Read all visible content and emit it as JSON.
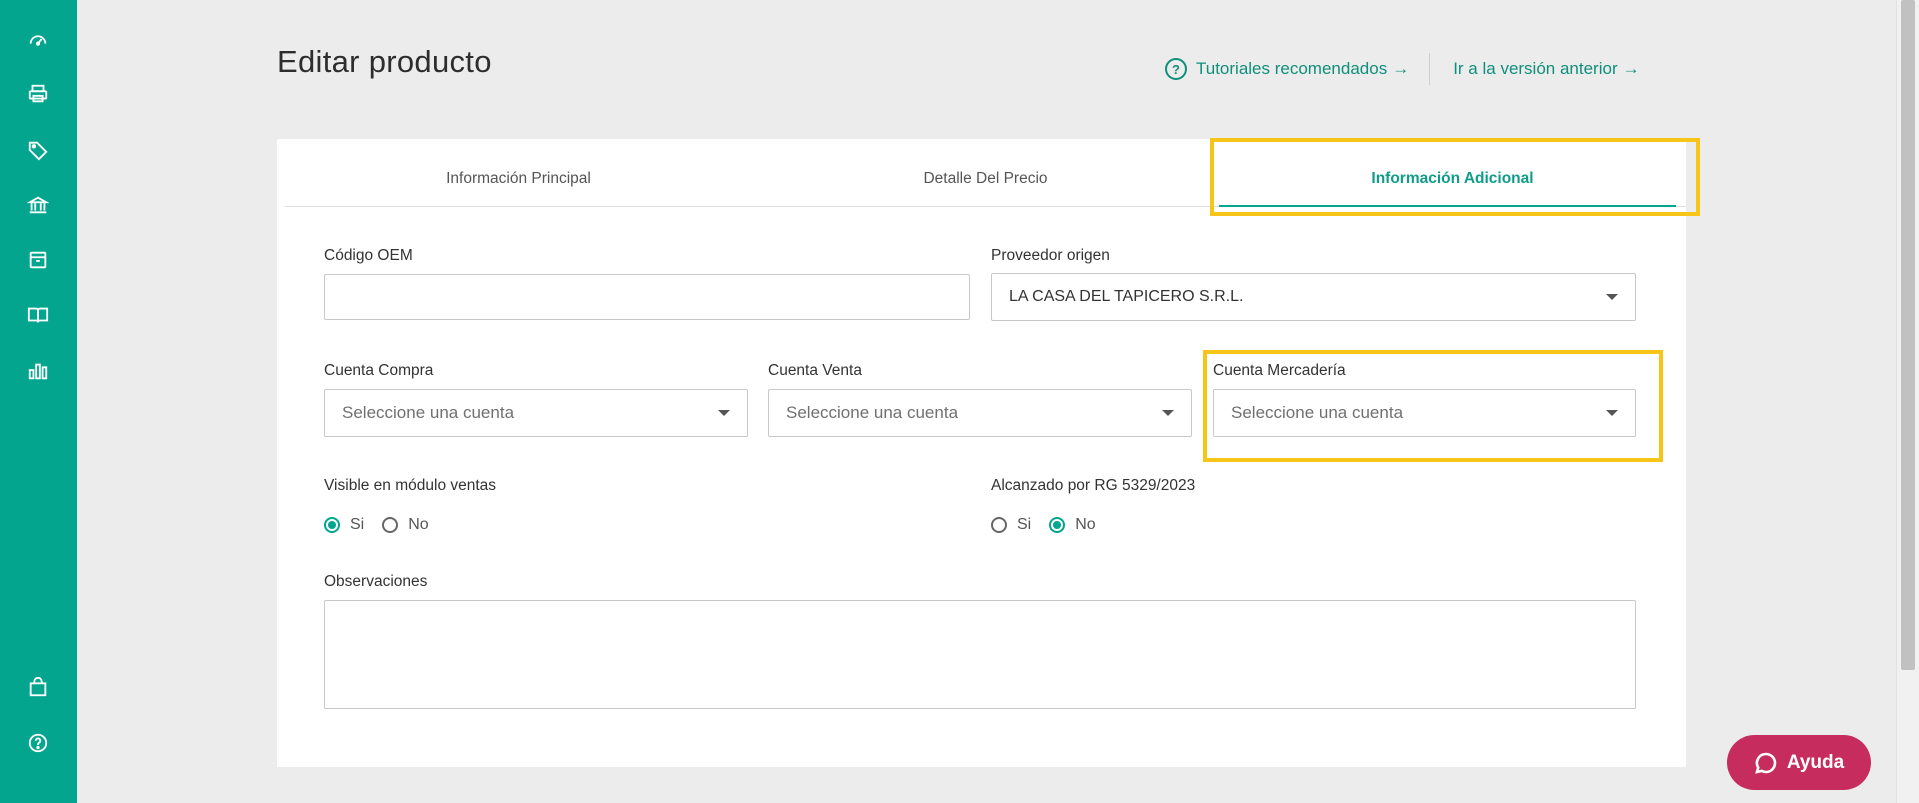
{
  "colors": {
    "brand": "#03a58f",
    "link": "#0f8f7b",
    "highlight": "#f6c518",
    "help_button": "#c62d5e"
  },
  "sidebar": {
    "items": [
      {
        "icon": "dashboard-icon"
      },
      {
        "icon": "printer-icon"
      },
      {
        "icon": "tag-icon"
      },
      {
        "icon": "bank-icon"
      },
      {
        "icon": "box-icon"
      },
      {
        "icon": "book-icon"
      },
      {
        "icon": "bar-chart-icon"
      }
    ],
    "bottom_items": [
      {
        "icon": "shopping-bag-icon"
      },
      {
        "icon": "help-icon"
      }
    ]
  },
  "header": {
    "title": "Editar producto",
    "tutorials_link": "Tutoriales recomendados",
    "previous_version_link": "Ir a la versión anterior",
    "arrow": "→"
  },
  "tabs": [
    {
      "label": "Información Principal",
      "active": false
    },
    {
      "label": "Detalle Del Precio",
      "active": false
    },
    {
      "label": "Información Adicional",
      "active": true
    }
  ],
  "form": {
    "codigo_oem": {
      "label": "Código OEM",
      "value": ""
    },
    "proveedor_origen": {
      "label": "Proveedor origen",
      "value": "LA CASA DEL TAPICERO S.R.L."
    },
    "cuenta_compra": {
      "label": "Cuenta Compra",
      "placeholder": "Seleccione una cuenta"
    },
    "cuenta_venta": {
      "label": "Cuenta Venta",
      "placeholder": "Seleccione una cuenta"
    },
    "cuenta_mercaderia": {
      "label": "Cuenta Mercadería",
      "placeholder": "Seleccione una cuenta"
    },
    "visible_ventas": {
      "label": "Visible en módulo ventas",
      "options": [
        "Si",
        "No"
      ],
      "selected": "Si"
    },
    "alcanzado_rg": {
      "label": "Alcanzado por RG 5329/2023",
      "options": [
        "Si",
        "No"
      ],
      "selected": "No"
    },
    "observaciones": {
      "label": "Observaciones",
      "value": ""
    }
  },
  "help_button": {
    "label": "Ayuda"
  }
}
